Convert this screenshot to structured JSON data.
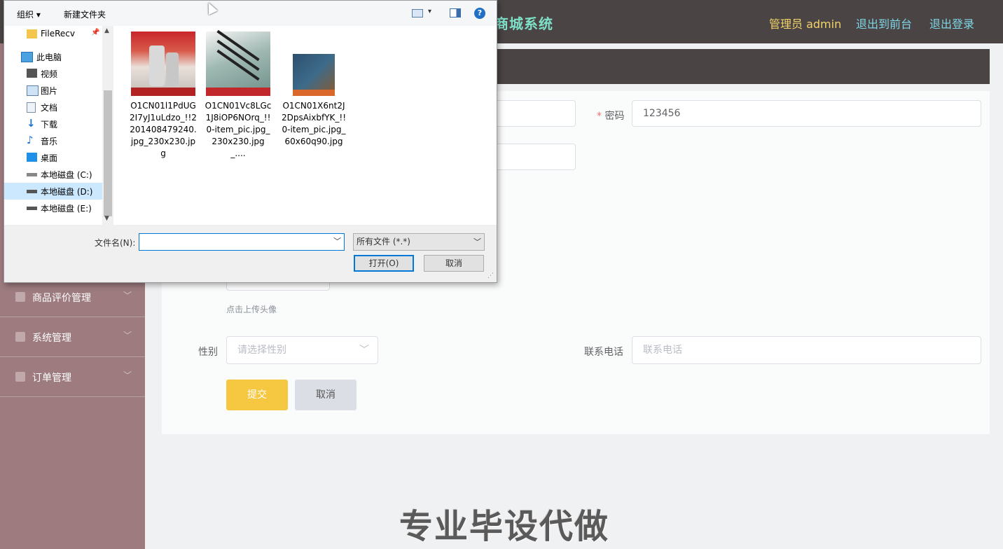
{
  "header": {
    "title": "商城系统",
    "admin": "管理员 admin",
    "link_front": "退出到前台",
    "link_logout": "退出登录"
  },
  "sidebar": {
    "items": [
      {
        "label": "商品评价管理"
      },
      {
        "label": "系统管理"
      },
      {
        "label": "订单管理"
      }
    ]
  },
  "form": {
    "password_label": "密码",
    "password_value": "123456",
    "avatar_hint": "点击上传头像",
    "gender_label": "性别",
    "gender_placeholder": "请选择性别",
    "phone_label": "联系电话",
    "phone_placeholder": "联系电话",
    "submit": "提交",
    "cancel": "取消"
  },
  "watermark": "专业毕设代做",
  "dialog": {
    "toolbar": {
      "organize": "组织",
      "new_folder": "新建文件夹"
    },
    "tree": [
      {
        "label": "FileRecv",
        "icon": "folder-icon"
      },
      {
        "label": "此电脑",
        "icon": "computer-icon"
      },
      {
        "label": "视频",
        "icon": "video-icon"
      },
      {
        "label": "图片",
        "icon": "pictures-icon"
      },
      {
        "label": "文档",
        "icon": "documents-icon"
      },
      {
        "label": "下载",
        "icon": "download-icon"
      },
      {
        "label": "音乐",
        "icon": "music-icon"
      },
      {
        "label": "桌面",
        "icon": "desktop-icon"
      },
      {
        "label": "本地磁盘 (C:)",
        "icon": "drive-icon"
      },
      {
        "label": "本地磁盘 (D:)",
        "icon": "drive-icon"
      },
      {
        "label": "本地磁盘 (E:)",
        "icon": "drive-icon"
      }
    ],
    "files": [
      {
        "name": "O1CN01l1PdUG2I7yJ1uLdzo_!!2201408479240.jpg_230x230.jpg"
      },
      {
        "name": "O1CN01Vc8LGc1J8iOP6NOrq_!!0-item_pic.jpg_230x230.jpg_...."
      },
      {
        "name": "O1CN01X6nt2J2DpsAixbfYK_!!0-item_pic.jpg_60x60q90.jpg"
      }
    ],
    "filename_label": "文件名(N):",
    "filename_value": "",
    "filter": "所有文件 (*.*)",
    "open": "打开(O)",
    "cancel": "取消"
  }
}
